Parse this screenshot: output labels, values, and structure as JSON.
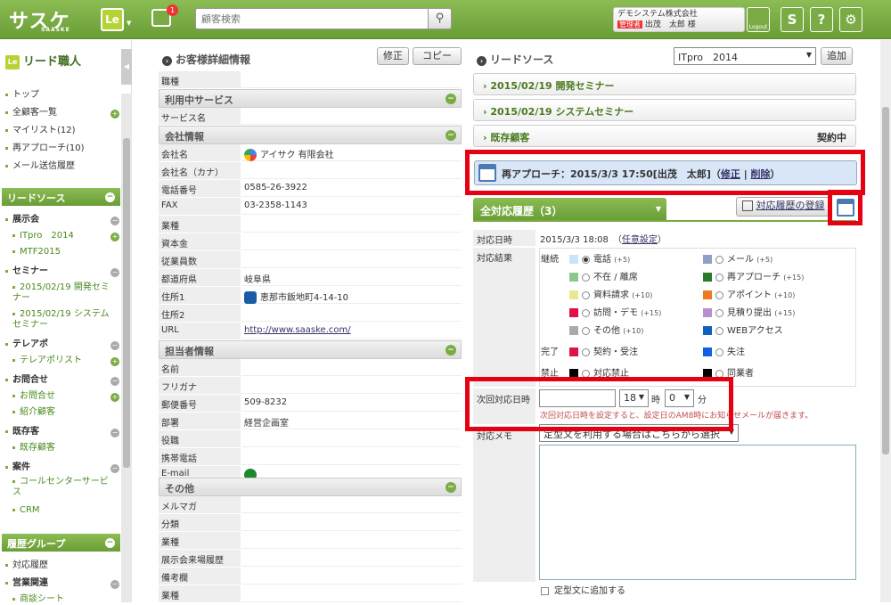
{
  "header": {
    "logo": "サスケ",
    "logo_sub": "SAASKE",
    "le": "Le",
    "badge": "1",
    "search_placeholder": "顧客検索",
    "company": "デモシステム株式会社",
    "role": "管理者",
    "user": "出茂　太郎 様",
    "logout": "Logout"
  },
  "sidebar": {
    "brand": "リード職人",
    "top": [
      {
        "label": "トップ"
      },
      {
        "label": "全顧客一覧"
      },
      {
        "label": "マイリスト(12)"
      },
      {
        "label": "再アプローチ(10)"
      },
      {
        "label": "メール送信履歴"
      }
    ],
    "lead_title": "リードソース",
    "lead": [
      {
        "label": "展示会"
      },
      {
        "label": "ITpro　2014"
      },
      {
        "label": "MTF2015"
      },
      {
        "label": "セミナー"
      },
      {
        "label": "2015/02/19 開発セミナー"
      },
      {
        "label": "2015/02/19 システムセミナー"
      },
      {
        "label": "テレアポ"
      },
      {
        "label": "テレアポリスト"
      },
      {
        "label": "お問合せ"
      },
      {
        "label": "お問合せ"
      },
      {
        "label": "紹介顧客"
      },
      {
        "label": "既存客"
      },
      {
        "label": "既存顧客"
      },
      {
        "label": "案件"
      },
      {
        "label": "コールセンターサービス"
      },
      {
        "label": "CRM"
      }
    ],
    "hist_title": "履歴グループ",
    "hist": [
      {
        "label": "対応履歴"
      },
      {
        "label": "営業関連"
      },
      {
        "label": "商談シート"
      }
    ]
  },
  "detail": {
    "title": "お客様詳細情報",
    "edit": "修正",
    "copy": "コピー",
    "r0": {
      "k": "職種",
      "v": ""
    },
    "g_service": "利用中サービス",
    "r1": {
      "k": "サービス名",
      "v": ""
    },
    "g_company": "会社情報",
    "rows_company": [
      {
        "k": "会社名",
        "v": "アイサク 有限会社"
      },
      {
        "k": "会社名（カナ）",
        "v": ""
      },
      {
        "k": "電話番号",
        "v": "0585-26-3922"
      },
      {
        "k": "FAX",
        "v": "03-2358-1143"
      },
      {
        "k": "業種",
        "v": ""
      },
      {
        "k": "資本金",
        "v": ""
      },
      {
        "k": "従業員数",
        "v": ""
      },
      {
        "k": "都道府県",
        "v": "岐阜県"
      },
      {
        "k": "住所1",
        "v": "恵那市飯地町4-14-10"
      },
      {
        "k": "住所2",
        "v": ""
      },
      {
        "k": "URL",
        "v": "http://www.saaske.com/"
      }
    ],
    "g_person": "担当者情報",
    "rows_person": [
      {
        "k": "名前",
        "v": ""
      },
      {
        "k": "フリガナ",
        "v": ""
      },
      {
        "k": "郵便番号",
        "v": "509-8232"
      },
      {
        "k": "部署",
        "v": "経営企画室"
      },
      {
        "k": "役職",
        "v": ""
      },
      {
        "k": "携帯電話",
        "v": ""
      },
      {
        "k": "E-mail",
        "v": ""
      }
    ],
    "g_other": "その他",
    "rows_other": [
      {
        "k": "メルマガ",
        "v": ""
      },
      {
        "k": "分類",
        "v": ""
      },
      {
        "k": "業種",
        "v": ""
      },
      {
        "k": "展示会来場履歴",
        "v": ""
      },
      {
        "k": "備考欄",
        "v": ""
      },
      {
        "k": "業種",
        "v": ""
      }
    ]
  },
  "lead": {
    "title": "リードソース",
    "select": "ITpro　2014",
    "add": "追加",
    "items": [
      {
        "label": "2015/02/19 開発セミナー",
        "status": ""
      },
      {
        "label": "2015/02/19 システムセミナー",
        "status": ""
      },
      {
        "label": "既存顧客",
        "status": "契約中"
      }
    ],
    "reapproach": "再アプローチ：2015/3/3 17:50[出茂　太郎]（",
    "edit": "修正",
    "del": "削除",
    "close_paren": "）"
  },
  "history": {
    "tab": "全対応履歴（3）",
    "register": "対応履歴の登録",
    "date_label": "対応日時",
    "date_value": "2015/3/3 18:08",
    "date_link": "任意設定",
    "date_open": "（",
    "date_close": "）",
    "result_label": "対応結果",
    "cont": "継続",
    "done": "完了",
    "ban": "禁止",
    "opts": [
      {
        "label": "電話",
        "count": "(+5)",
        "color": "#c9e4f8"
      },
      {
        "label": "メール",
        "count": "(+5)",
        "color": "#8ea0c8"
      },
      {
        "label": "不在 / 離席",
        "count": "",
        "color": "#8cc88c"
      },
      {
        "label": "再アプローチ",
        "count": "(+15)",
        "color": "#2a7a2a"
      },
      {
        "label": "資料請求",
        "count": "(+10)",
        "color": "#e8e890"
      },
      {
        "label": "アポイント",
        "count": "(+10)",
        "color": "#f07820"
      },
      {
        "label": "訪問・デモ",
        "count": "(+15)",
        "color": "#e0104a"
      },
      {
        "label": "見積り提出",
        "count": "(+15)",
        "color": "#b890d0"
      },
      {
        "label": "その他",
        "count": "(+10)",
        "color": "#aaaaaa"
      },
      {
        "label": "WEBアクセス",
        "count": "",
        "color": "#1060c0"
      },
      {
        "label": "契約・受注",
        "count": "",
        "color": "#e0104a"
      },
      {
        "label": "失注",
        "count": "",
        "color": "#1060e0"
      },
      {
        "label": "対応禁止",
        "count": "",
        "color": "#000000"
      },
      {
        "label": "同業者",
        "count": "",
        "color": "#000000"
      }
    ],
    "next_label": "次回対応日時",
    "hour": "18",
    "hour_unit": "時",
    "min": "0",
    "min_unit": "分",
    "next_note": "次回対応日時を設定すると、設定日のAM8時にお知らせメールが届きます。",
    "memo_label": "対応メモ",
    "template_select": "定型文を利用する場合はこちらから選択",
    "add_template": "定型文に追加する"
  }
}
